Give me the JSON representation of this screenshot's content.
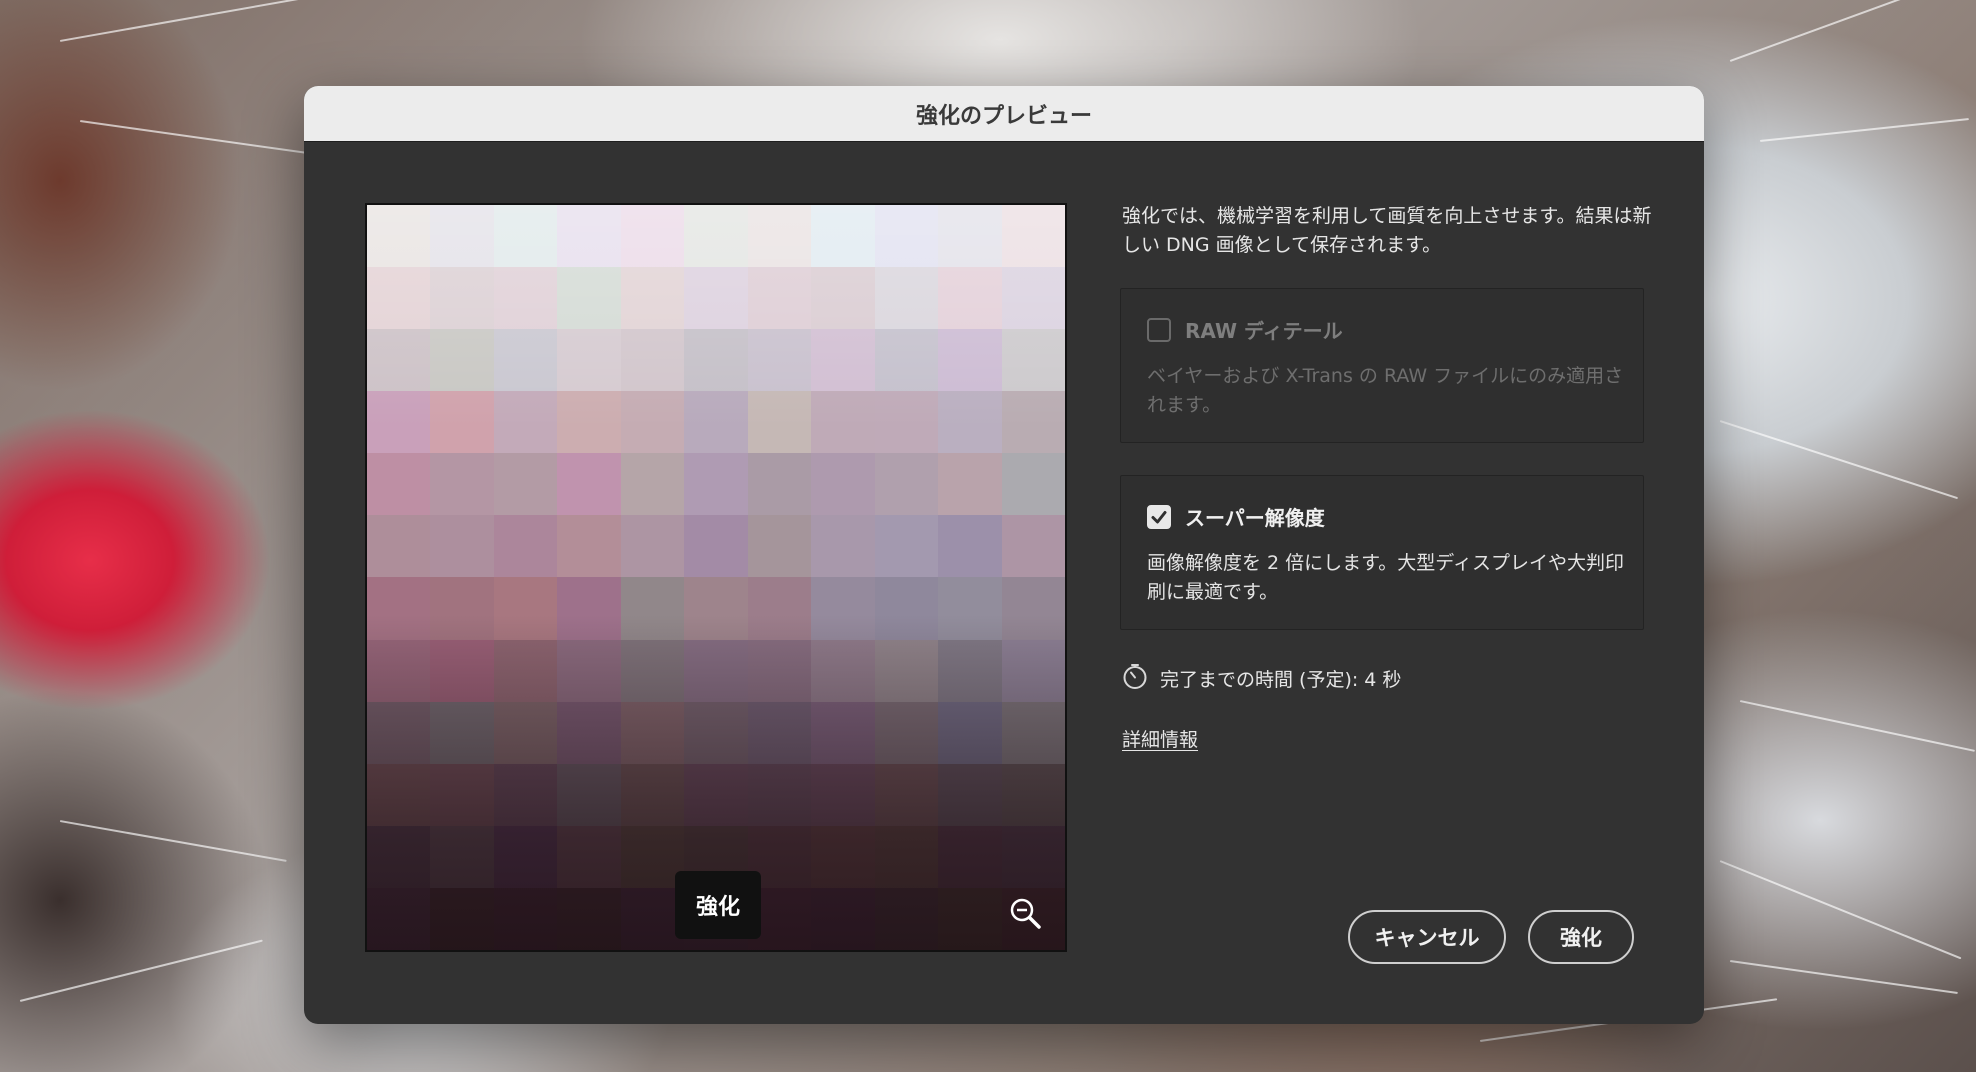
{
  "dialog": {
    "title": "強化のプレビュー"
  },
  "preview": {
    "overlay_label": "強化",
    "zoom_icon": "zoom-out-icon"
  },
  "description": "強化では、機械学習を利用して画質を向上させます。結果は新しい DNG 画像として保存されます。",
  "options": {
    "raw_detail": {
      "label": "RAW ディテール",
      "checked": false,
      "enabled": false,
      "description": "ベイヤーおよび X-Trans の RAW ファイルにのみ適用されます。"
    },
    "super_resolution": {
      "label": "スーパー解像度",
      "checked": true,
      "enabled": true,
      "description": "画像解像度を 2 倍にします。大型ディスプレイや大判印刷に最適です。"
    }
  },
  "estimate": {
    "icon": "stopwatch-icon",
    "text": "完了までの時間 (予定): 4 秒"
  },
  "learn_more": "詳細情報",
  "buttons": {
    "cancel": "キャンセル",
    "enhance": "強化"
  },
  "colors": {
    "dialog_bg": "#323232",
    "titlebar_bg": "#ececec",
    "text": "#e6e6e6",
    "disabled_text": "#7e7e7e"
  }
}
